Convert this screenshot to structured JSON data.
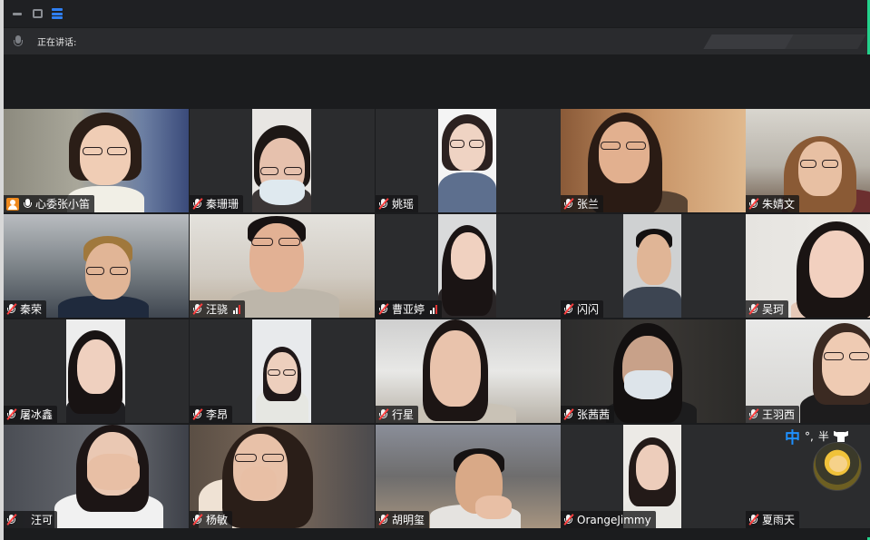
{
  "window": {
    "speaking_label": "正在讲话:"
  },
  "participants": [
    {
      "name": "心委张小笛",
      "host": true,
      "muted": false
    },
    {
      "name": "秦珊珊",
      "muted": true
    },
    {
      "name": "姚瑶",
      "muted": true
    },
    {
      "name": "张兰",
      "muted": true
    },
    {
      "name": "朱婧文",
      "muted": true
    },
    {
      "name": "秦荣",
      "muted": true
    },
    {
      "name": "汪骁",
      "muted": true,
      "signal": true
    },
    {
      "name": "曹亚婷",
      "muted": true,
      "signal": true
    },
    {
      "name": "闪闪",
      "muted": true
    },
    {
      "name": "吴珂",
      "muted": true
    },
    {
      "name": "屠冰鑫",
      "muted": true
    },
    {
      "name": "李昂",
      "muted": true
    },
    {
      "name": "行星",
      "muted": true
    },
    {
      "name": "张茜茜",
      "muted": true
    },
    {
      "name": "王羽西",
      "muted": true
    },
    {
      "name": "汪可",
      "muted": true
    },
    {
      "name": "杨敏",
      "muted": true
    },
    {
      "name": "胡明玺",
      "muted": true
    },
    {
      "name": "OrangeJimmy",
      "muted": true
    },
    {
      "name": "夏雨天",
      "muted": true
    }
  ],
  "ime": {
    "mode": "中",
    "punct": "°,",
    "width": "半"
  },
  "colors": {
    "accent": "#2f7ff2",
    "muted_slash": "#ff4040",
    "host_badge": "#f08a1c",
    "ime_blue": "#1e90ff",
    "edge_green": "#23d18b"
  }
}
